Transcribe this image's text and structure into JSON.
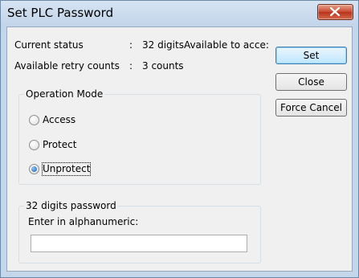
{
  "window": {
    "title": "Set PLC Password"
  },
  "status": {
    "current_status_label": "Current status",
    "current_status_sep": ":",
    "current_status_value": "32 digitsAvailable to acce:",
    "retry_label": "Available retry counts",
    "retry_sep": ":",
    "retry_value": "3 counts"
  },
  "buttons": {
    "set_label": "Set",
    "close_label": "Close",
    "force_cancel_label": "Force Cancel"
  },
  "operation_mode": {
    "title": "Operation Mode",
    "options": [
      {
        "label": "Access",
        "selected": false
      },
      {
        "label": "Protect",
        "selected": false
      },
      {
        "label": "Unprotect",
        "selected": true
      }
    ]
  },
  "password": {
    "title": "32 digits password",
    "prompt": "Enter in alphanumeric:",
    "value": "",
    "placeholder": ""
  },
  "colors": {
    "title_bar": "#c4d6ea",
    "client_bg": "#f0f0f0",
    "close_button": "#c9462c",
    "radio_selected": "#1b5fa8"
  }
}
